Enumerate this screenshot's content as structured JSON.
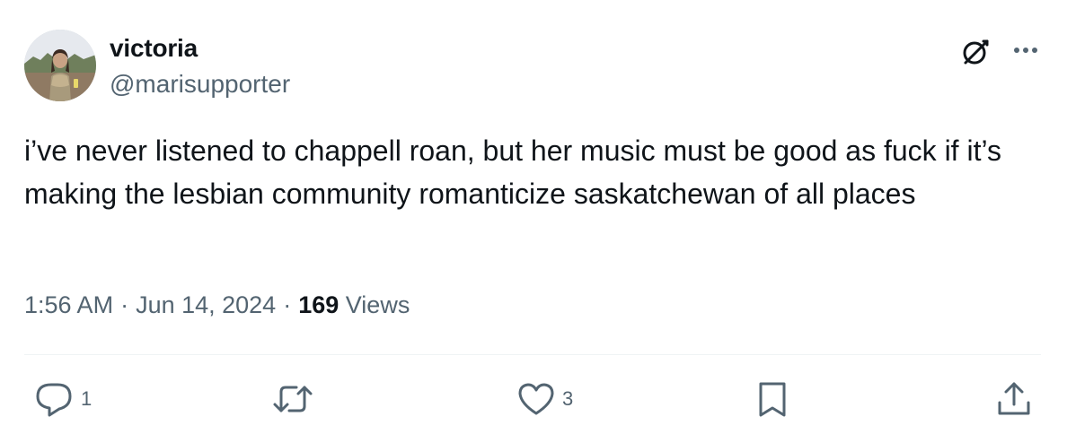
{
  "user": {
    "display_name": "victoria",
    "handle": "@marisupporter",
    "avatar_icon": "profile-photo"
  },
  "header_icons": {
    "grok": "grok-icon",
    "more": "more-icon"
  },
  "tweet": {
    "text": "i’ve never listened to chappell roan, but her music must be good as fuck if it’s making the lesbian community romanticize saskatchewan of all places"
  },
  "meta": {
    "time": "1:56 AM",
    "separator": "·",
    "date": "Jun 14, 2024",
    "views_count": "169",
    "views_label": "Views"
  },
  "actions": {
    "reply": {
      "icon": "reply-icon",
      "count": "1"
    },
    "retweet": {
      "icon": "retweet-icon",
      "count": ""
    },
    "like": {
      "icon": "heart-icon",
      "count": "3"
    },
    "bookmark": {
      "icon": "bookmark-icon",
      "count": ""
    },
    "share": {
      "icon": "share-icon",
      "count": ""
    }
  },
  "colors": {
    "text_primary": "#0f1419",
    "text_secondary": "#536471",
    "divider": "#eff3f4"
  }
}
